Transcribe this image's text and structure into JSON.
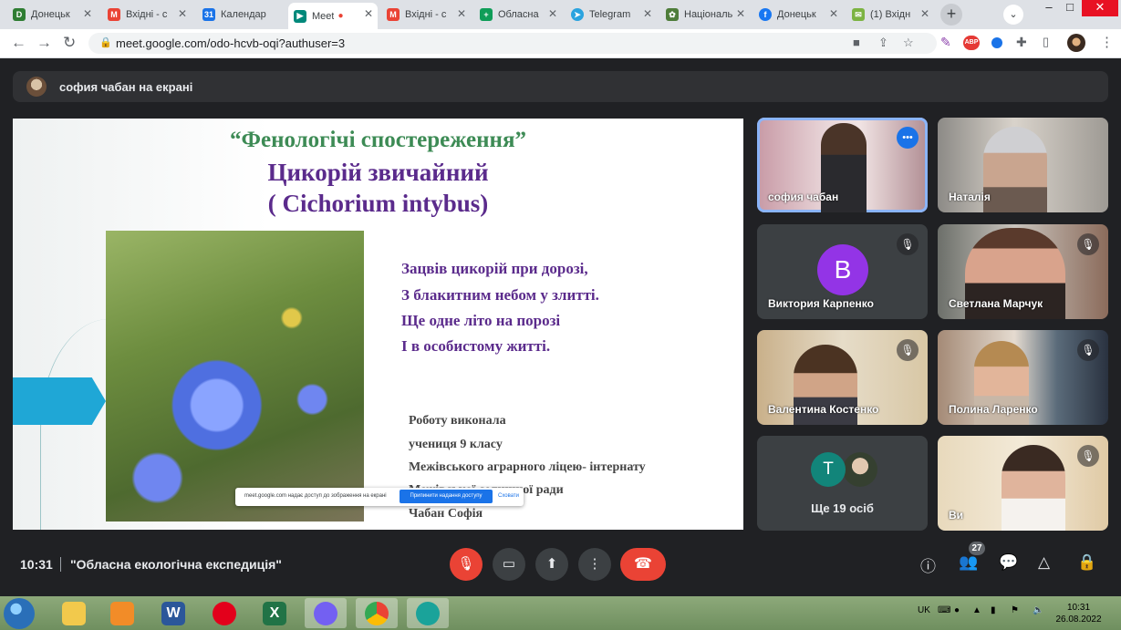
{
  "browser": {
    "tabs": [
      {
        "label": "Донецьк",
        "favicon": "D",
        "color": "#2e7d32"
      },
      {
        "label": "Вхідні - с",
        "favicon": "M",
        "color": "#ea4335"
      },
      {
        "label": "Календар",
        "favicon": "31",
        "color": "#1a73e8"
      },
      {
        "label": "Meet",
        "favicon": "▶",
        "color": "#00897b",
        "recording": "●"
      },
      {
        "label": "Вхідні - с",
        "favicon": "M",
        "color": "#ea4335"
      },
      {
        "label": "Обласна",
        "favicon": "+",
        "color": "#0f9d58"
      },
      {
        "label": "Telegram",
        "favicon": "➤",
        "color": "#2aa3df"
      },
      {
        "label": "Національ",
        "favicon": "✿",
        "color": "#4e7d3a"
      },
      {
        "label": "Донецьк",
        "favicon": "f",
        "color": "#1877f2"
      },
      {
        "label": "(1) Вхідн",
        "favicon": "✉",
        "color": "#7cb342"
      }
    ],
    "url": "meet.google.com/odo-hcvb-oqi?authuser=3",
    "extensions": {
      "abp": "ABP"
    }
  },
  "meet": {
    "presenting_banner": "софия чабан на екрані",
    "slide": {
      "title_line1": "“Фенологічі спостереження”",
      "title_line2": "Цикорій звичайний",
      "title_line3": "( Cichorium intybus)",
      "poem": [
        "Зацвів цикорій при дорозі,",
        "З блакитним небом у злитті.",
        "Ще одне літо на порозі",
        "І в особистому житті."
      ],
      "author": [
        "Роботу виконала",
        "учениця 9 класу",
        "Межівського аграрного ліцею- інтернату",
        "Межівської селищної ради",
        "Чабан Софія"
      ]
    },
    "share_popup": {
      "text": "meet.google.com надає доступ до зображення на екрані",
      "stop_button": "Припинити надання доступу",
      "hide_link": "Сховати"
    },
    "participants": [
      {
        "name": "софия чабан",
        "speaking": true,
        "bg": "#c9a7b0"
      },
      {
        "name": "Наталія",
        "bg": "#b9a99a"
      },
      {
        "name": "Виктория Карпенко",
        "initial": "В"
      },
      {
        "name": "Светлана Марчук",
        "bg": "#8d6e63"
      },
      {
        "name": "Валентина Костенко",
        "bg": "#d2b48c"
      },
      {
        "name": "Полина Ларенко",
        "bg": "#b38b6d"
      },
      {
        "more_initial": "T",
        "more_label": "Ще 19 осіб"
      },
      {
        "name": "Ви",
        "bg": "#e6cfae"
      }
    ],
    "bottom": {
      "time": "10:31",
      "meeting_name": "\"Обласна екологічна експедиція\"",
      "people_count": "27"
    }
  },
  "taskbar": {
    "word": "W",
    "excel": "X",
    "lang": "UK",
    "time": "10:31",
    "date": "26.08.2022"
  }
}
